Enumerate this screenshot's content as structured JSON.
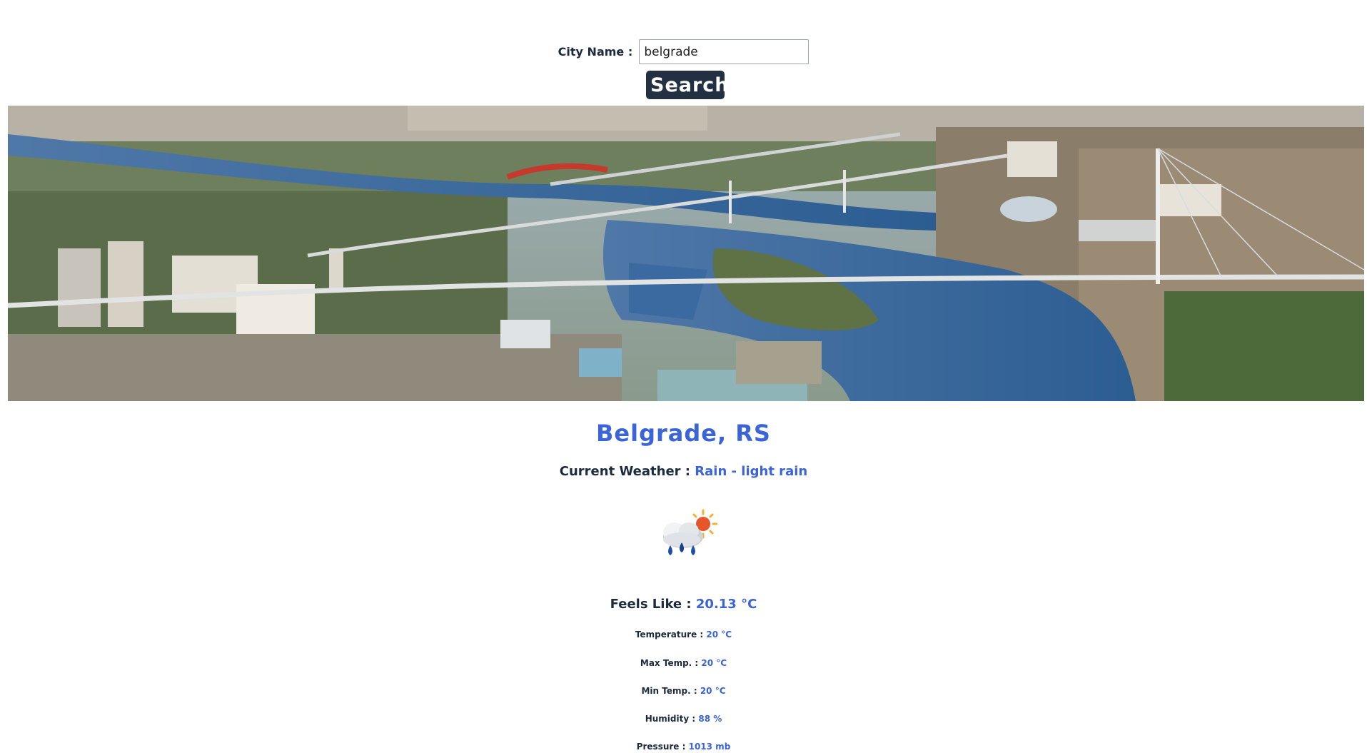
{
  "search": {
    "label": "City Name :",
    "value": "belgrade",
    "button_label": "Search"
  },
  "city_image": {
    "alt": "Aerial view of Belgrade rivers and bridges"
  },
  "location": {
    "title": "Belgrade, RS"
  },
  "current_weather": {
    "label": "Current Weather :",
    "value": "Rain - light rain",
    "icon": "rain-sun-icon"
  },
  "feels_like": {
    "label": "Feels Like :",
    "value": "20.13 °C"
  },
  "stats": [
    {
      "label": "Temperature :",
      "value": "20 °C"
    },
    {
      "label": "Max Temp. :",
      "value": "20 °C"
    },
    {
      "label": "Min Temp. :",
      "value": "20 °C"
    },
    {
      "label": "Humidity :",
      "value": "88 %"
    },
    {
      "label": "Pressure :",
      "value": "1013 mb"
    }
  ],
  "colors": {
    "accent": "#3a64d8",
    "button_bg": "#223041",
    "text": "#1c2a3e"
  }
}
